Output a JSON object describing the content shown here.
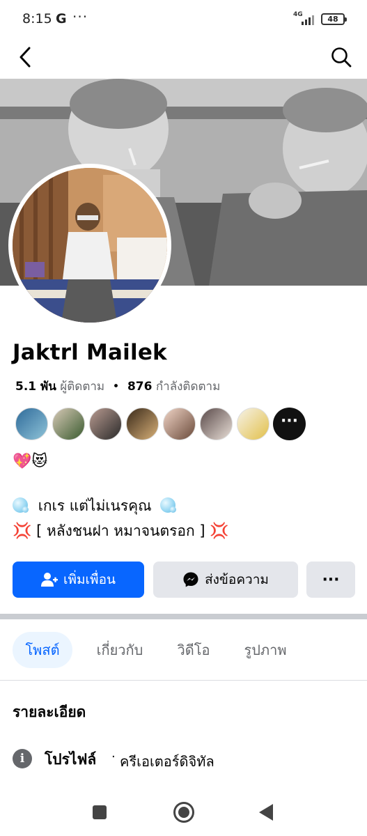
{
  "status_bar": {
    "time": "8:15",
    "g_label": "G",
    "more_dots": "···",
    "network": "4G",
    "battery": "48"
  },
  "profile": {
    "name": "Jaktrl Mailek",
    "followers_count": "5.1 พัน",
    "followers_label": "ผู้ติดตาม",
    "separator": "•",
    "following_count": "876",
    "following_label": "กำลังติดตาม",
    "friends_more": "···",
    "emoji_line": "💖😻",
    "bio_line1": "เกเร แต่ไม่เนรคุณ",
    "bio_line2_prefix": "💢",
    "bio_line2": "[ หลังชนฝา หมาจนตรอก ]",
    "bio_line2_suffix": "💢"
  },
  "actions": {
    "add_friend": "เพิ่มเพื่อน",
    "message": "ส่งข้อความ",
    "more": "···"
  },
  "tabs": [
    {
      "label": "โพสต์"
    },
    {
      "label": "เกี่ยวกับ"
    },
    {
      "label": "วิดีโอ"
    },
    {
      "label": "รูปภาพ"
    }
  ],
  "details": {
    "heading": "รายละเอียด",
    "info_glyph": "i",
    "profile_label": "โปรไฟล์",
    "separator": "·",
    "profile_value": "ครีเอเตอร์ดิจิทัล"
  },
  "colors": {
    "primary": "#0866ff",
    "secondary_button": "#e4e6eb",
    "muted_text": "#65676b",
    "selected_tab_bg": "#ebf5ff"
  }
}
